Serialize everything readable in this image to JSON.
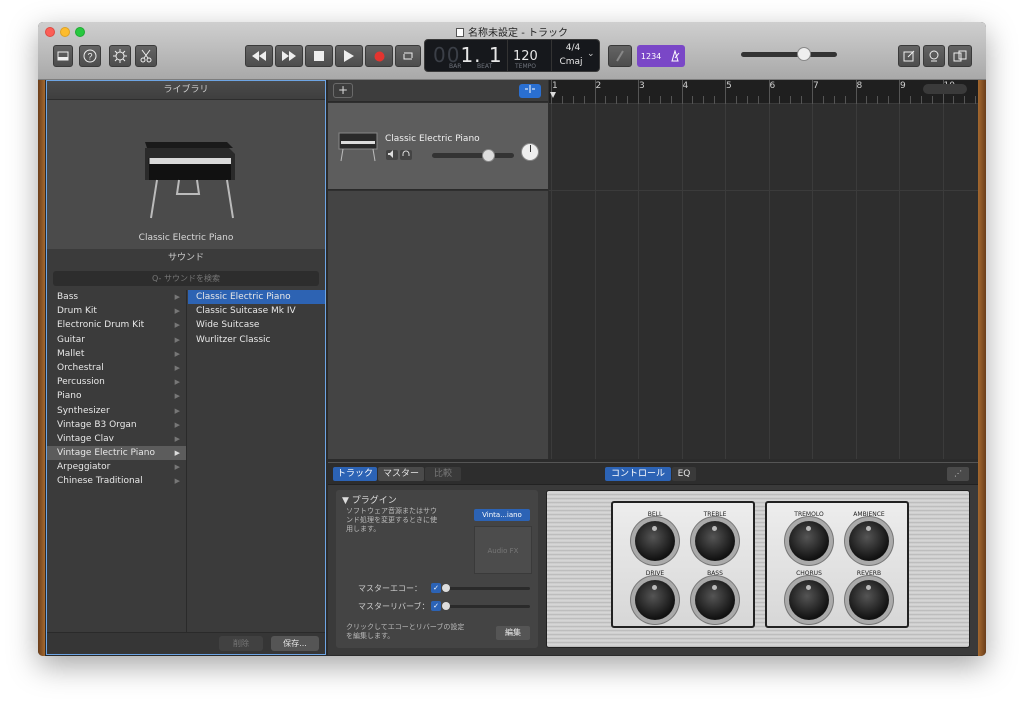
{
  "window": {
    "title": "名称未設定 - トラック",
    "colors": {
      "accent": "#2c63b5",
      "count_in": "#7a47c7",
      "close": "#fc5f57",
      "minimize": "#fdbc2e",
      "maximize": "#28c840"
    }
  },
  "toolbar": {
    "lcd": {
      "bar_beat_dim": "00",
      "bar_beat": "1. 1",
      "bar_label": "BAR",
      "beat_label": "BEAT",
      "tempo": "120",
      "tempo_label": "TEMPO",
      "time_signature": "4/4",
      "key": "Cmaj"
    },
    "count_in": "1234",
    "master_volume": 0.7
  },
  "library": {
    "header": "ライブラリ",
    "preview_name": "Classic Electric Piano",
    "sound_header": "サウンド",
    "search_placeholder": "Q- サウンドを検索",
    "categories": [
      "Bass",
      "Drum Kit",
      "Electronic Drum Kit",
      "Guitar",
      "Mallet",
      "Orchestral",
      "Percussion",
      "Piano",
      "Synthesizer",
      "Vintage B3 Organ",
      "Vintage Clav",
      "Vintage Electric Piano",
      "Arpeggiator",
      "Chinese Traditional"
    ],
    "selected_category": "Vintage Electric Piano",
    "patches": [
      "Classic Electric Piano",
      "Classic Suitcase Mk IV",
      "Wide Suitcase",
      "Wurlitzer Classic"
    ],
    "selected_patch": "Classic Electric Piano",
    "delete_label": "削除",
    "save_label": "保存..."
  },
  "tracks": {
    "name": "Classic Electric Piano",
    "volume": 0.68,
    "ruler": [
      "1",
      "2",
      "3",
      "4",
      "5",
      "6",
      "7",
      "8",
      "9",
      "10"
    ]
  },
  "smart_controls": {
    "tabs": {
      "track": "トラック",
      "master": "マスター",
      "compare": "比較",
      "controls": "コントロール",
      "eq": "EQ"
    },
    "plugin_title": "▼ プラグイン",
    "plugin_desc": "ソフトウェア音源またはサウンド処理を変更するときに使用します。",
    "plugin_select": "Vinta...iano",
    "audio_fx": "Audio FX",
    "master_echo": "マスターエコー：",
    "master_reverb": "マスターリバーブ：",
    "note": "クリックしてエコーとリバーブの設定を編集します。",
    "edit_label": "編集",
    "knobs_left": [
      "BELL",
      "TREBLE",
      "DRIVE",
      "BASS"
    ],
    "knobs_right": [
      "TREMOLO",
      "AMBIENCE",
      "CHORUS",
      "REVERB"
    ]
  }
}
